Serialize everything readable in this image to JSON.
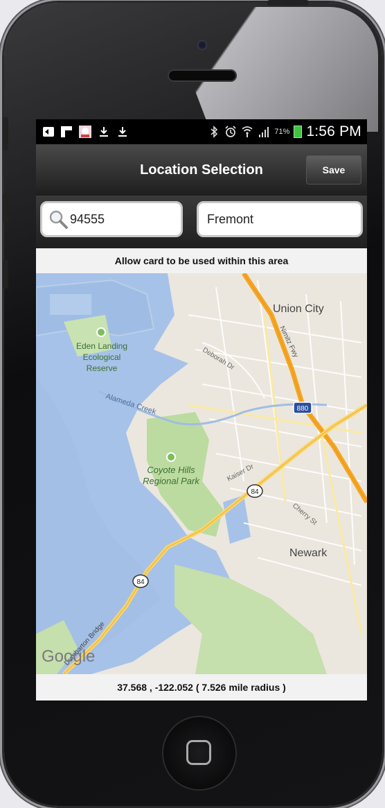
{
  "status_bar": {
    "icons": [
      "back-arrow-icon",
      "flipboard-icon",
      "app-icon",
      "download-icon",
      "download-icon",
      "bluetooth-icon",
      "alarm-icon",
      "wifi-icon",
      "signal-icon"
    ],
    "battery": "71%",
    "time": "1:56 PM"
  },
  "header": {
    "title": "Location Selection",
    "save_label": "Save"
  },
  "search": {
    "zip_value": "94555",
    "city_value": "Fremont"
  },
  "map": {
    "caption": "Allow card to be used within this area",
    "labels": {
      "union_city": "Union City",
      "eden_1": "Eden Landing",
      "eden_2": "Ecological",
      "eden_3": "Reserve",
      "deborah": "Deborah Dr",
      "nimitz": "Nimitz Fwy",
      "i880": "880",
      "alameda_creek": "Alameda Creek",
      "coyote_1": "Coyote Hills",
      "coyote_2": "Regional Park",
      "kaiser": "Kaiser Dr",
      "r84a": "84",
      "cherry": "Cherry St",
      "newark": "Newark",
      "r84b": "84",
      "bridge": "Dumbarton Bridge",
      "google": "Google"
    }
  },
  "footer": {
    "coords": "37.568 , -122.052 ( 7.526  mile radius )"
  }
}
